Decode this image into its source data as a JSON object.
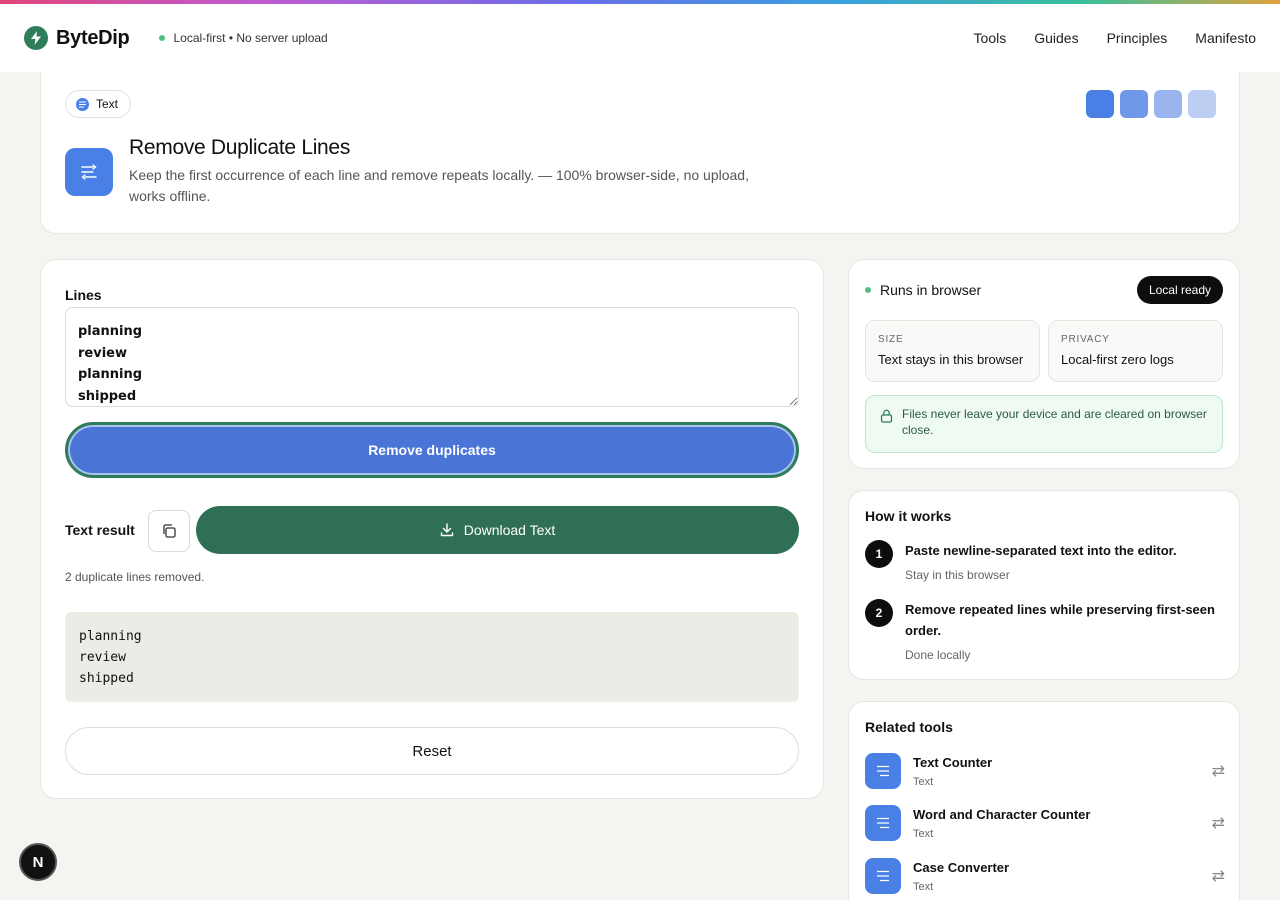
{
  "header": {
    "brand": "ByteDip",
    "tagline": "Local-first • No server upload",
    "nav": [
      "Tools",
      "Guides",
      "Principles",
      "Manifesto"
    ]
  },
  "hero": {
    "chip": "Text",
    "title": "Remove Duplicate Lines",
    "description": "Keep the first occurrence of each line and remove repeats locally. — 100% browser-side, no upload, works offline.",
    "swatches": [
      "#4a7fe6",
      "#6f97ea",
      "#97b4ee",
      "#bccff3"
    ]
  },
  "editor": {
    "label": "Lines",
    "value": "planning\nreview\nplanning\nshipped",
    "primary_button": "Remove duplicates",
    "result_label": "Text result",
    "download_button": "Download Text",
    "status": "2 duplicate lines removed.",
    "output": "planning\nreview\nshipped",
    "reset_button": "Reset"
  },
  "runtime": {
    "title": "Runs in browser",
    "badge": "Local ready",
    "size_key": "SIZE",
    "size_value": "Text stays in this browser",
    "privacy_key": "PRIVACY",
    "privacy_value": "Local-first zero logs",
    "notice": "Files never leave your device and are cleared on browser close."
  },
  "how": {
    "title": "How it works",
    "steps": [
      {
        "num": "1",
        "text": "Paste newline-separated text into the editor.",
        "sub": "Stay in this browser"
      },
      {
        "num": "2",
        "text": "Remove repeated lines while preserving first-seen order.",
        "sub": "Done locally"
      }
    ]
  },
  "related": {
    "title": "Related tools",
    "items": [
      {
        "name": "Text Counter",
        "category": "Text"
      },
      {
        "name": "Word and Character Counter",
        "category": "Text"
      },
      {
        "name": "Case Converter",
        "category": "Text"
      }
    ]
  },
  "devtools": {
    "label": "N"
  },
  "colors": {
    "accent": "#4a7fe6",
    "primary_button": "#4a74d6",
    "download_button": "#2f6f55",
    "brand": "#2f7d5a",
    "success_dot": "#4fbf87"
  }
}
